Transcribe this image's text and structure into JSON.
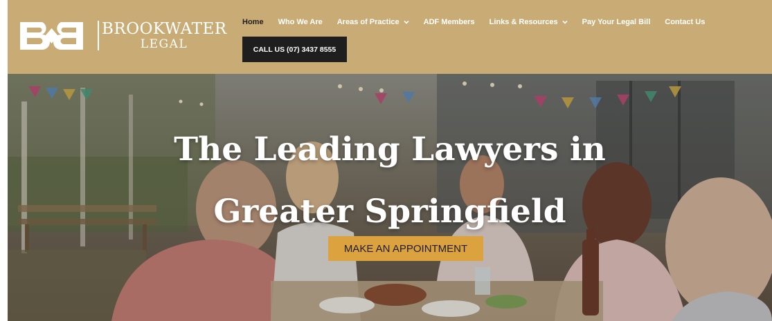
{
  "brand": {
    "name_line1": "BROOKWATER",
    "name_line2": "LEGAL",
    "logo_icon": "bb-monogram-icon"
  },
  "nav": {
    "items": [
      {
        "label": "Home",
        "active": true
      },
      {
        "label": "Who We Are"
      },
      {
        "label": "Areas of Practice",
        "dropdown": true
      },
      {
        "label": "ADF Members"
      },
      {
        "label": "Links & Resources",
        "dropdown": true
      },
      {
        "label": "Pay Your Legal Bill"
      },
      {
        "label": "Contact Us"
      }
    ],
    "call_label": "CALL US (07) 3437 8555"
  },
  "hero": {
    "title_line1": "The Leading Lawyers in",
    "title_line2": "Greater Springfield",
    "cta_label": "MAKE AN APPOINTMENT"
  },
  "colors": {
    "header_bg": "#c9ac75",
    "cta_bg": "#dca23f",
    "call_bg": "#1e1e1e",
    "active_nav": "#1f1f1f"
  }
}
